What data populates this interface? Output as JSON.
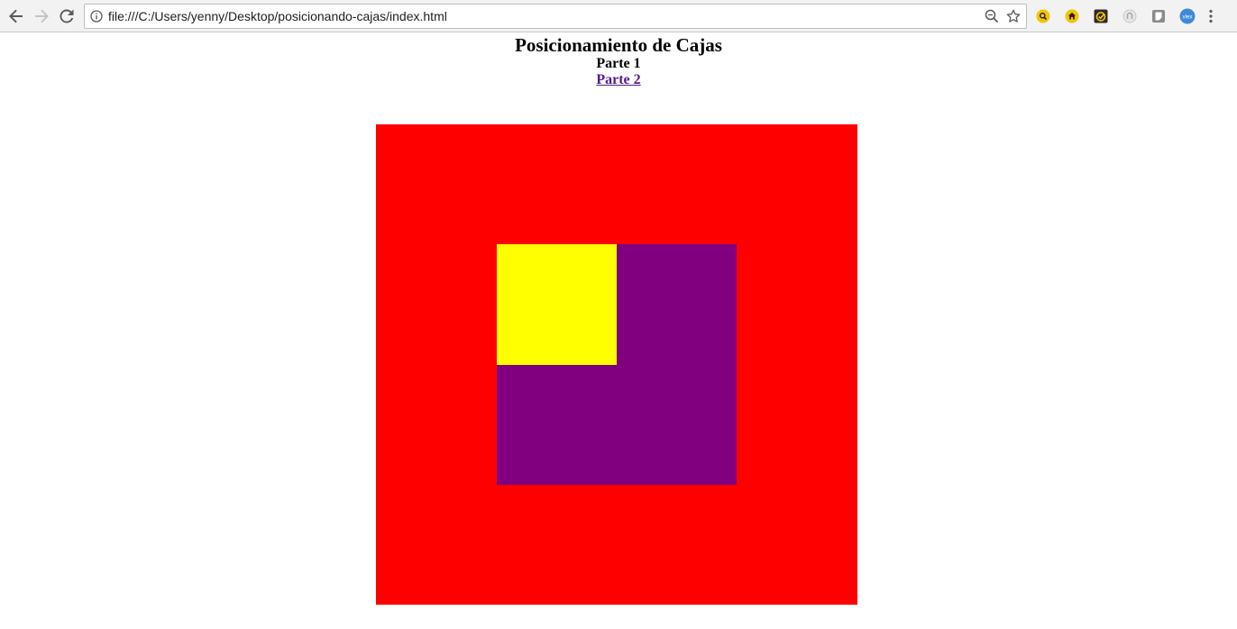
{
  "browser": {
    "url": "file:///C:/Users/yenny/Desktop/posicionando-cajas/index.html",
    "icons": [
      "back-icon",
      "forward-icon",
      "reload-icon",
      "info-icon",
      "zoom-icon",
      "star-icon",
      "menu-icon"
    ],
    "extensions": [
      "search-extension-icon",
      "home-extension-icon",
      "check-extension-icon",
      "gray-extension-icon",
      "note-extension-icon",
      "vlex-extension-icon"
    ],
    "vlex_label": "vlex"
  },
  "page": {
    "title": "Posicionamiento de Cajas",
    "subtitle": "Parte 1",
    "link_label": "Parte 2"
  },
  "boxes": {
    "outer_color": "#ff0000",
    "middle_color": "#800080",
    "inner_color": "#ffff00"
  },
  "colors": {
    "link": "#551a8b"
  }
}
